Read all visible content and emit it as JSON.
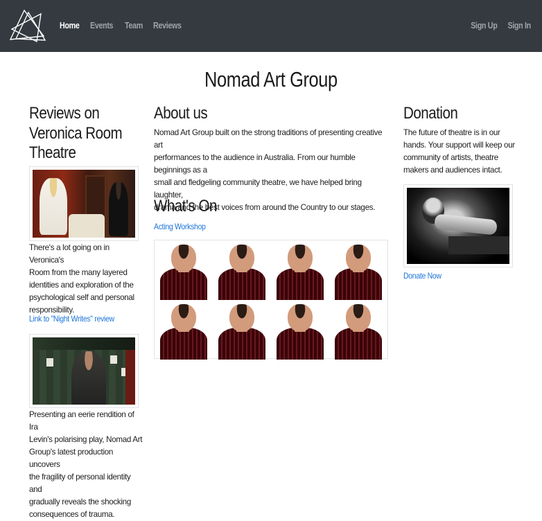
{
  "nav": {
    "links": [
      {
        "label": "Home",
        "active": true
      },
      {
        "label": "Events",
        "active": false
      },
      {
        "label": "Team",
        "active": false
      },
      {
        "label": "Reviews",
        "active": false
      }
    ],
    "sign_up": "Sign Up",
    "sign_in": "Sign In"
  },
  "page_title": "Nomad Art Group",
  "reviews": {
    "heading_lines": [
      "Reviews on",
      "Veronica Room",
      "Theatre"
    ],
    "review1_lines": [
      "There's a lot going on in Veronica's",
      "Room from the many layered",
      "identities and exploration of the",
      "psychological self and personal",
      "responsibility."
    ],
    "review1_link": "Link to \"Night Writes\" review",
    "review2_lines": [
      "Presenting an eerie rendition of Ira",
      "Levin's polarising play, Nomad Art",
      "Group's latest production uncovers",
      "the fragility of personal identity and",
      "gradually reveals the shocking",
      "consequences of trauma."
    ]
  },
  "about": {
    "heading": "About us",
    "lines": [
      "Nomad Art Group built on the strong traditions of presenting creative art",
      "performances to the audience in Australia. From our humble beginnings as a",
      "small and fledgeling community theatre, we have helped bring laughter,",
      "drama and the best voices from around the Country to our stages."
    ]
  },
  "whats_on": {
    "heading": "What's On",
    "link": "Acting Workshop"
  },
  "donation": {
    "heading": "Donation",
    "lines": [
      "The future of theatre is in our",
      "hands. Your support will keep our",
      "community of artists, theatre",
      "makers and audiences intact."
    ],
    "link": "Donate Now"
  },
  "colors": {
    "navbar": "#343a40",
    "nav_active": "#ffffff",
    "nav_inactive": "#9ea3a8",
    "link": "#1a73d9"
  }
}
